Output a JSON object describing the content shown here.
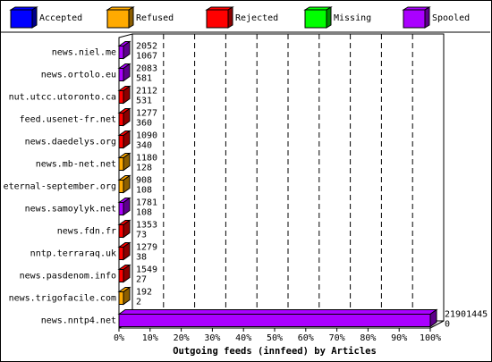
{
  "chart_data": {
    "type": "bar",
    "orientation": "horizontal",
    "title": "",
    "xlabel": "Outgoing feeds (innfeed) by Articles",
    "ylabel": "",
    "xlim": [
      0,
      100
    ],
    "x_unit": "%",
    "x_ticks": [
      "0%",
      "10%",
      "20%",
      "30%",
      "40%",
      "50%",
      "60%",
      "70%",
      "80%",
      "90%",
      "100%"
    ],
    "grid": "vertical dashed",
    "legend_position": "top",
    "legend": [
      {
        "name": "Accepted",
        "color": "#0000ff"
      },
      {
        "name": "Refused",
        "color": "#ffaa00"
      },
      {
        "name": "Rejected",
        "color": "#ff0000"
      },
      {
        "name": "Missing",
        "color": "#00ff00"
      },
      {
        "name": "Spooled",
        "color": "#aa00ff"
      }
    ],
    "categories": [
      "news.niel.me",
      "news.ortolo.eu",
      "nut.utcc.utoronto.ca",
      "feed.usenet-fr.net",
      "news.daedelys.org",
      "news.mb-net.net",
      "eternal-september.org",
      "news.samoylyk.net",
      "news.fdn.fr",
      "nntp.terraraq.uk",
      "news.pasdenom.info",
      "news.trigofacile.com",
      "news.nntp4.net"
    ],
    "offered": [
      2052,
      2083,
      2112,
      1277,
      1090,
      1180,
      908,
      1781,
      1353,
      1279,
      1549,
      192,
      21901445
    ],
    "accepted": [
      1067,
      581,
      531,
      360,
      340,
      128,
      108,
      108,
      73,
      38,
      27,
      2,
      0
    ],
    "dominant_category": [
      "Spooled",
      "Spooled",
      "Rejected",
      "Rejected",
      "Rejected",
      "Refused",
      "Refused",
      "Spooled",
      "Rejected",
      "Rejected",
      "Rejected",
      "Refused",
      "Spooled"
    ],
    "percent_of_total": [
      0.0094,
      0.0095,
      0.0096,
      0.0058,
      0.005,
      0.0054,
      0.0041,
      0.0081,
      0.0062,
      0.0058,
      0.0071,
      0.0009,
      100
    ]
  }
}
